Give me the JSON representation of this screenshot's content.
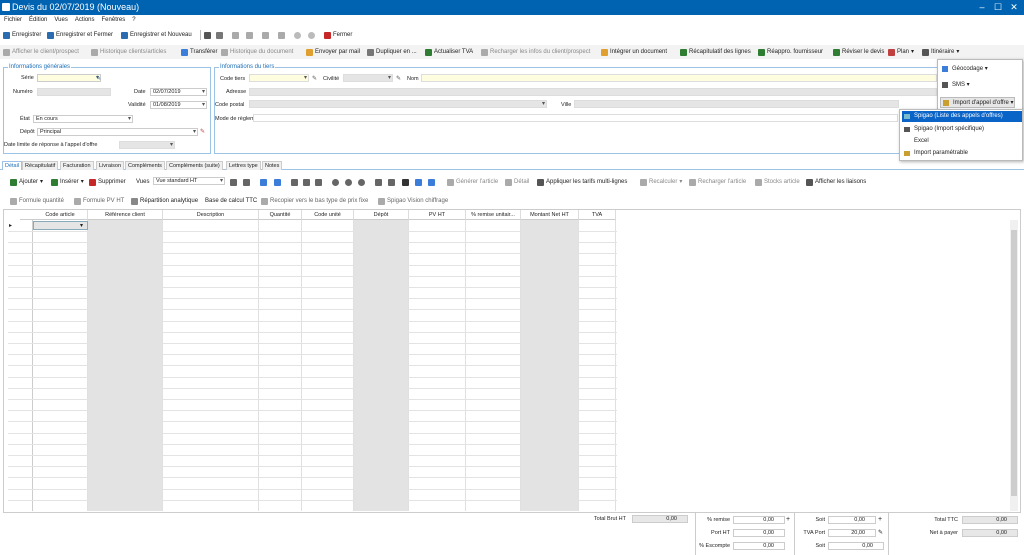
{
  "window": {
    "title": "Devis du 02/07/2019 (Nouveau)",
    "min": "–",
    "max": "☐",
    "close": "✕"
  },
  "menu": [
    "Fichier",
    "Édition",
    "Vues",
    "Actions",
    "Fenêtres",
    "?"
  ],
  "toolbar1": {
    "save": "Enregistrer",
    "save_close": "Enregistrer et Fermer",
    "save_new": "Enregistrer et Nouveau",
    "close": "Fermer"
  },
  "toolbar2": [
    "Afficher le client/prospect",
    "Historique clients/articles",
    "Transférer",
    "Historique du document",
    "Envoyer par mail",
    "Dupliquer en ...",
    "Actualiser TVA",
    "Recharger les infos du client/prospect",
    "Intégrer un document",
    "Récapitulatif des lignes",
    "Réappro. fournisseur",
    "Réviser le devis",
    "Plan",
    "Itinéraire"
  ],
  "general": {
    "legend": "Informations générales",
    "serie_label": "Série",
    "numero_label": "Numéro",
    "date_label": "Date",
    "date_value": "02/07/2019",
    "validite_label": "Validité",
    "validite_value": "01/08/2019",
    "etat_label": "État",
    "etat_value": "En cours",
    "depot_label": "Dépôt",
    "depot_value": "Principal",
    "limite_label": "Date limite de réponse à l'appel d'offre"
  },
  "tiers": {
    "legend": "Informations du tiers",
    "code_label": "Code tiers",
    "civilite_label": "Civilité",
    "nom_label": "Nom",
    "adresse_label": "Adresse",
    "cp_label": "Code postal",
    "ville_label": "Ville",
    "reglement_label": "Mode de règlement"
  },
  "popup": {
    "geocodage": "Géocodage",
    "sms": "SMS",
    "import": "Import d'appel d'offre"
  },
  "submenu": [
    "Spigao (Liste des appels d'offres)",
    "Spigao (Import spécifique)",
    "Excel",
    "Import paramétrable"
  ],
  "tabs": [
    "Détail",
    "Récapitulatif",
    "Facturation",
    "Livraison",
    "Compléments",
    "Compléments (suite)",
    "Lettres type",
    "Notes"
  ],
  "lines_toolbar": {
    "ajouter": "Ajouter",
    "inserer": "Insérer",
    "supprimer": "Supprimer",
    "vues": "Vues",
    "vue_value": "Vue standard HT",
    "generer": "Générer l'article",
    "detail": "Détail",
    "appliquer": "Appliquer les tarifs multi-lignes",
    "recalculer": "Recalculer",
    "recharger": "Recharger l'article",
    "stocks": "Stocks article",
    "liaisons": "Afficher les liaisons"
  },
  "lines_toolbar2": [
    "Formule quantité",
    "Formule PV HT",
    "Répartition analytique",
    "Base de calcul TTC",
    "Recopier vers le bas type de prix fixe",
    "Spigao Vision chiffrage"
  ],
  "columns": [
    "Code article",
    "Référence client",
    "Description",
    "Quantité",
    "Code unité",
    "Dépôt",
    "PV HT",
    "% remise unitair...",
    "Montant Net HT",
    "TVA"
  ],
  "totals": {
    "brut_label": "Total Brut HT",
    "brut": "0,00",
    "remise_label": "% remise",
    "remise": "0,00",
    "port_label": "Port HT",
    "port": "0,00",
    "escompte_label": "% Escompte",
    "escompte": "0,00",
    "soit_label": "Soit",
    "soit1": "0,00",
    "tva_port_label": "TVA Port",
    "tva_port": "20,00",
    "soit2": "0,00",
    "ttc_label": "Total TTC",
    "ttc": "0,00",
    "net_label": "Net à payer",
    "net": "0,00"
  },
  "colors": {
    "accent": "#0063b1",
    "highlight": "#0a64c8",
    "yellow_field": "#fffde0"
  }
}
